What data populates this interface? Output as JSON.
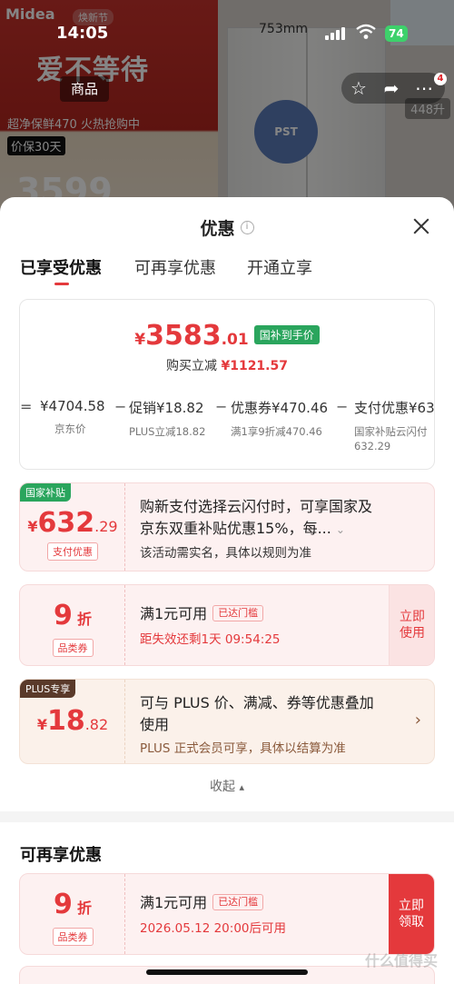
{
  "background": {
    "brand": "Midea",
    "brand_event": "焕新节",
    "promo_title": "爱不等待",
    "promo_sub": "超净保鲜470 火热抢购中",
    "promo_tag": "价保30天",
    "promo_price": "3599",
    "dimension": "753mm",
    "pst_label": "PST",
    "size_chip": "448升"
  },
  "status_bar": {
    "time": "14:05",
    "battery": "74"
  },
  "nav": {
    "tab_label": "商品",
    "cart_count": "4"
  },
  "sheet": {
    "title": "优惠",
    "info_glyph": "i",
    "tabs": [
      {
        "label": "已享受优惠",
        "active": true
      },
      {
        "label": "可再享优惠",
        "active": false
      },
      {
        "label": "开通立享",
        "active": false
      }
    ],
    "summary": {
      "currency": "¥",
      "price_int": "3583",
      "price_dec": ".01",
      "price_tag": "国补到手价",
      "reduce_label": "购买立减",
      "reduce_amount": "¥1121.57",
      "breakdown": [
        {
          "value": "¥4704.58",
          "sub": "京东价"
        },
        {
          "value": "促销¥18.82",
          "sub": "PLUS立减18.82"
        },
        {
          "value": "优惠券¥470.46",
          "sub": "满1享9折减470.46"
        },
        {
          "value": "支付优惠¥63",
          "sub": "国家补贴云闪付\n632.29"
        }
      ],
      "op_first": "=",
      "op_minus": "−"
    },
    "coupons": [
      {
        "corner": "国家补贴",
        "currency": "¥",
        "amount_int": "632",
        "amount_dec": ".29",
        "mini_tag": "支付优惠",
        "title": "购新支付选择云闪付时，可享国家及",
        "title2": "京东双重补贴优惠15%，每...",
        "sub": "该活动需实名，具体以规则为准"
      },
      {
        "amount_int": "9",
        "amount_unit": "折",
        "mini_tag": "品类券",
        "title": "满1元可用",
        "threshold": "已达门槛",
        "sub": "距失效还剩1天 09:54:25",
        "action": "立即使用",
        "action_l1": "立即",
        "action_l2": "使用"
      },
      {
        "corner": "PLUS专享",
        "currency": "¥",
        "amount_int": "18",
        "amount_dec": ".82",
        "title": "可与 PLUS 价、满减、券等优惠叠加",
        "title2": "使用",
        "sub": "PLUS 正式会员可享，具体以结算为准"
      }
    ],
    "collapse_label": "收起",
    "section2_title": "可再享优惠",
    "coupon_more": {
      "amount_int": "9",
      "amount_unit": "折",
      "mini_tag": "品类券",
      "title": "满1元可用",
      "threshold": "已达门槛",
      "sub": "2026.05.12 20:00后可用",
      "action_l1": "立即",
      "action_l2": "领取"
    }
  },
  "watermark": "什么值得买",
  "colors": {
    "accent": "#e4393c",
    "green": "#2aa55d",
    "plus": "#5a3a2a"
  }
}
